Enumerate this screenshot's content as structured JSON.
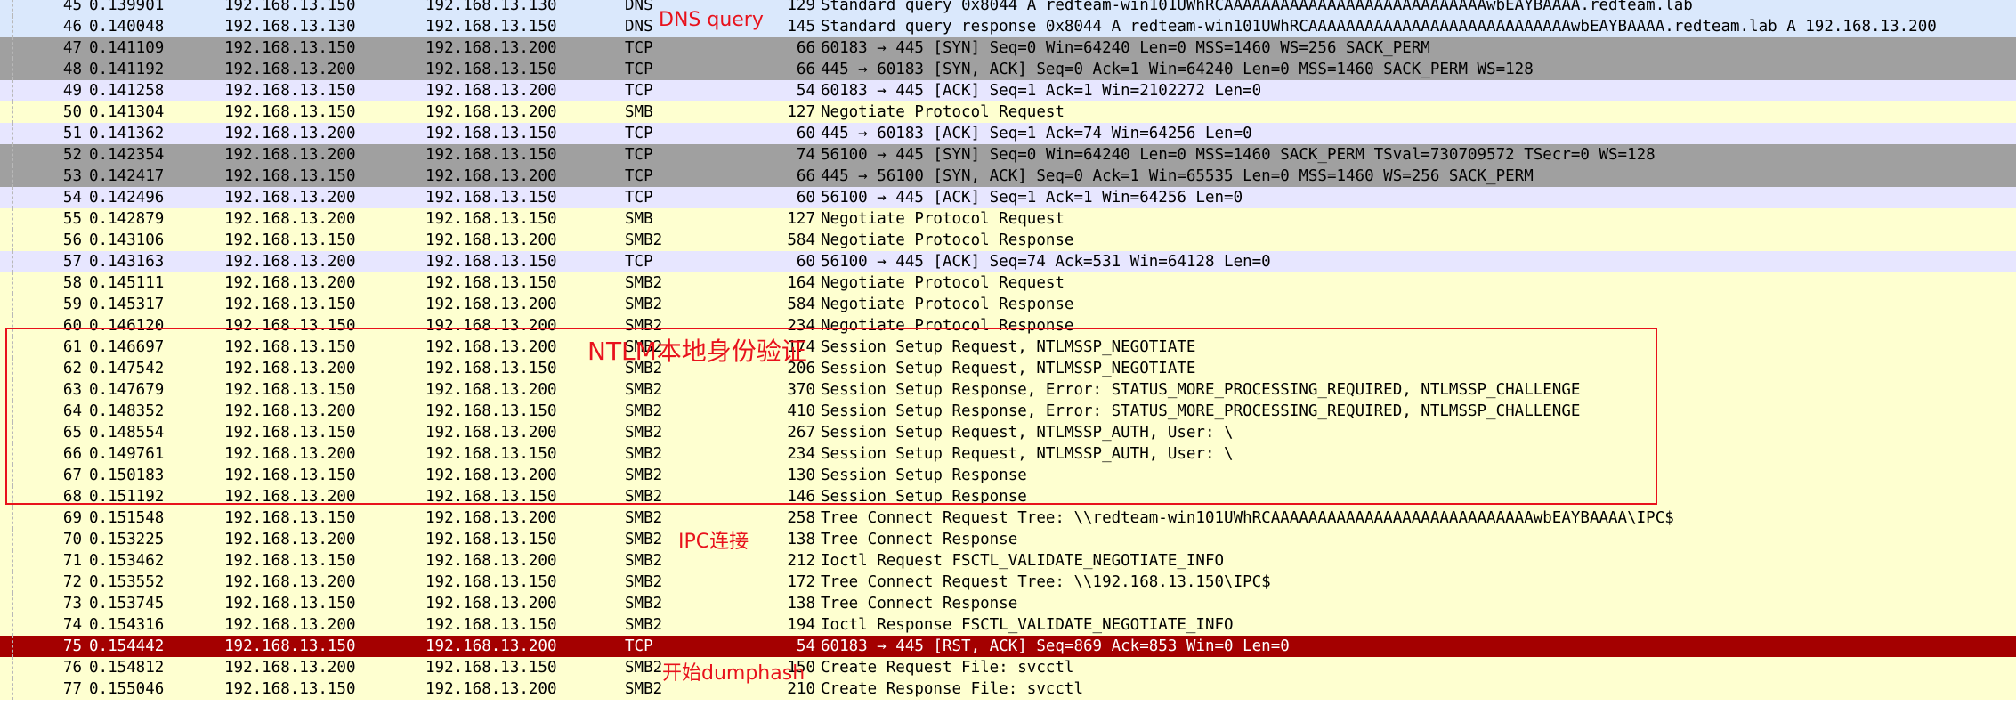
{
  "colors": {
    "dns": "#dae8fc",
    "tcp_handshake": "#a0a0a0",
    "tcp": "#e7e6ff",
    "smb": "#feffd0",
    "rst": "#a40000",
    "annotation": "#e8121c"
  },
  "packets": [
    {
      "no": "45",
      "time": "0.139901",
      "src": "192.168.13.150",
      "dst": "192.168.13.130",
      "proto": "DNS",
      "len": "129",
      "info": "Standard query 0x8044 A redteam-win101UWhRCAAAAAAAAAAAAAAAAAAAAAAAAAAAAwbEAYBAAAA.redteam.lab",
      "style": "dns"
    },
    {
      "no": "46",
      "time": "0.140048",
      "src": "192.168.13.130",
      "dst": "192.168.13.150",
      "proto": "DNS",
      "len": "145",
      "info": "Standard query response 0x8044 A redteam-win101UWhRCAAAAAAAAAAAAAAAAAAAAAAAAAAAAwbEAYBAAAA.redteam.lab A 192.168.13.200",
      "style": "dns"
    },
    {
      "no": "47",
      "time": "0.141109",
      "src": "192.168.13.150",
      "dst": "192.168.13.200",
      "proto": "TCP",
      "len": "66",
      "info": "60183 → 445 [SYN] Seq=0 Win=64240 Len=0 MSS=1460 WS=256 SACK_PERM",
      "style": "tcp_handshake"
    },
    {
      "no": "48",
      "time": "0.141192",
      "src": "192.168.13.200",
      "dst": "192.168.13.150",
      "proto": "TCP",
      "len": "66",
      "info": "445 → 60183 [SYN, ACK] Seq=0 Ack=1 Win=64240 Len=0 MSS=1460 SACK_PERM WS=128",
      "style": "tcp_handshake"
    },
    {
      "no": "49",
      "time": "0.141258",
      "src": "192.168.13.150",
      "dst": "192.168.13.200",
      "proto": "TCP",
      "len": "54",
      "info": "60183 → 445 [ACK] Seq=1 Ack=1 Win=2102272 Len=0",
      "style": "tcp"
    },
    {
      "no": "50",
      "time": "0.141304",
      "src": "192.168.13.150",
      "dst": "192.168.13.200",
      "proto": "SMB",
      "len": "127",
      "info": "Negotiate Protocol Request",
      "style": "smb"
    },
    {
      "no": "51",
      "time": "0.141362",
      "src": "192.168.13.200",
      "dst": "192.168.13.150",
      "proto": "TCP",
      "len": "60",
      "info": "445 → 60183 [ACK] Seq=1 Ack=74 Win=64256 Len=0",
      "style": "tcp"
    },
    {
      "no": "52",
      "time": "0.142354",
      "src": "192.168.13.200",
      "dst": "192.168.13.150",
      "proto": "TCP",
      "len": "74",
      "info": "56100 → 445 [SYN] Seq=0 Win=64240 Len=0 MSS=1460 SACK_PERM TSval=730709572 TSecr=0 WS=128",
      "style": "tcp_handshake"
    },
    {
      "no": "53",
      "time": "0.142417",
      "src": "192.168.13.150",
      "dst": "192.168.13.200",
      "proto": "TCP",
      "len": "66",
      "info": "445 → 56100 [SYN, ACK] Seq=0 Ack=1 Win=65535 Len=0 MSS=1460 WS=256 SACK_PERM",
      "style": "tcp_handshake"
    },
    {
      "no": "54",
      "time": "0.142496",
      "src": "192.168.13.200",
      "dst": "192.168.13.150",
      "proto": "TCP",
      "len": "60",
      "info": "56100 → 445 [ACK] Seq=1 Ack=1 Win=64256 Len=0",
      "style": "tcp"
    },
    {
      "no": "55",
      "time": "0.142879",
      "src": "192.168.13.200",
      "dst": "192.168.13.150",
      "proto": "SMB",
      "len": "127",
      "info": "Negotiate Protocol Request",
      "style": "smb"
    },
    {
      "no": "56",
      "time": "0.143106",
      "src": "192.168.13.150",
      "dst": "192.168.13.200",
      "proto": "SMB2",
      "len": "584",
      "info": "Negotiate Protocol Response",
      "style": "smb"
    },
    {
      "no": "57",
      "time": "0.143163",
      "src": "192.168.13.200",
      "dst": "192.168.13.150",
      "proto": "TCP",
      "len": "60",
      "info": "56100 → 445 [ACK] Seq=74 Ack=531 Win=64128 Len=0",
      "style": "tcp"
    },
    {
      "no": "58",
      "time": "0.145111",
      "src": "192.168.13.200",
      "dst": "192.168.13.150",
      "proto": "SMB2",
      "len": "164",
      "info": "Negotiate Protocol Request",
      "style": "smb"
    },
    {
      "no": "59",
      "time": "0.145317",
      "src": "192.168.13.150",
      "dst": "192.168.13.200",
      "proto": "SMB2",
      "len": "584",
      "info": "Negotiate Protocol Response",
      "style": "smb"
    },
    {
      "no": "60",
      "time": "0.146120",
      "src": "192.168.13.150",
      "dst": "192.168.13.200",
      "proto": "SMB2",
      "len": "234",
      "info": "Negotiate Protocol Response",
      "style": "smb"
    },
    {
      "no": "61",
      "time": "0.146697",
      "src": "192.168.13.150",
      "dst": "192.168.13.200",
      "proto": "SMB2",
      "len": "174",
      "info": "Session Setup Request, NTLMSSP_NEGOTIATE",
      "style": "smb"
    },
    {
      "no": "62",
      "time": "0.147542",
      "src": "192.168.13.200",
      "dst": "192.168.13.150",
      "proto": "SMB2",
      "len": "206",
      "info": "Session Setup Request, NTLMSSP_NEGOTIATE",
      "style": "smb"
    },
    {
      "no": "63",
      "time": "0.147679",
      "src": "192.168.13.150",
      "dst": "192.168.13.200",
      "proto": "SMB2",
      "len": "370",
      "info": "Session Setup Response, Error: STATUS_MORE_PROCESSING_REQUIRED, NTLMSSP_CHALLENGE",
      "style": "smb"
    },
    {
      "no": "64",
      "time": "0.148352",
      "src": "192.168.13.200",
      "dst": "192.168.13.150",
      "proto": "SMB2",
      "len": "410",
      "info": "Session Setup Response, Error: STATUS_MORE_PROCESSING_REQUIRED, NTLMSSP_CHALLENGE",
      "style": "smb"
    },
    {
      "no": "65",
      "time": "0.148554",
      "src": "192.168.13.150",
      "dst": "192.168.13.200",
      "proto": "SMB2",
      "len": "267",
      "info": "Session Setup Request, NTLMSSP_AUTH, User: \\",
      "style": "smb"
    },
    {
      "no": "66",
      "time": "0.149761",
      "src": "192.168.13.200",
      "dst": "192.168.13.150",
      "proto": "SMB2",
      "len": "234",
      "info": "Session Setup Request, NTLMSSP_AUTH, User: \\",
      "style": "smb"
    },
    {
      "no": "67",
      "time": "0.150183",
      "src": "192.168.13.150",
      "dst": "192.168.13.200",
      "proto": "SMB2",
      "len": "130",
      "info": "Session Setup Response",
      "style": "smb"
    },
    {
      "no": "68",
      "time": "0.151192",
      "src": "192.168.13.200",
      "dst": "192.168.13.150",
      "proto": "SMB2",
      "len": "146",
      "info": "Session Setup Response",
      "style": "smb"
    },
    {
      "no": "69",
      "time": "0.151548",
      "src": "192.168.13.150",
      "dst": "192.168.13.200",
      "proto": "SMB2",
      "len": "258",
      "info": "Tree Connect Request Tree: \\\\redteam-win101UWhRCAAAAAAAAAAAAAAAAAAAAAAAAAAAAwbEAYBAAAA\\IPC$",
      "style": "smb"
    },
    {
      "no": "70",
      "time": "0.153225",
      "src": "192.168.13.200",
      "dst": "192.168.13.150",
      "proto": "SMB2",
      "len": "138",
      "info": "Tree Connect Response",
      "style": "smb"
    },
    {
      "no": "71",
      "time": "0.153462",
      "src": "192.168.13.150",
      "dst": "192.168.13.200",
      "proto": "SMB2",
      "len": "212",
      "info": "Ioctl Request FSCTL_VALIDATE_NEGOTIATE_INFO",
      "style": "smb"
    },
    {
      "no": "72",
      "time": "0.153552",
      "src": "192.168.13.200",
      "dst": "192.168.13.150",
      "proto": "SMB2",
      "len": "172",
      "info": "Tree Connect Request Tree: \\\\192.168.13.150\\IPC$",
      "style": "smb"
    },
    {
      "no": "73",
      "time": "0.153745",
      "src": "192.168.13.150",
      "dst": "192.168.13.200",
      "proto": "SMB2",
      "len": "138",
      "info": "Tree Connect Response",
      "style": "smb"
    },
    {
      "no": "74",
      "time": "0.154316",
      "src": "192.168.13.200",
      "dst": "192.168.13.150",
      "proto": "SMB2",
      "len": "194",
      "info": "Ioctl Response FSCTL_VALIDATE_NEGOTIATE_INFO",
      "style": "smb"
    },
    {
      "no": "75",
      "time": "0.154442",
      "src": "192.168.13.150",
      "dst": "192.168.13.200",
      "proto": "TCP",
      "len": "54",
      "info": "60183 → 445 [RST, ACK] Seq=869 Ack=853 Win=0 Len=0",
      "style": "rst"
    },
    {
      "no": "76",
      "time": "0.154812",
      "src": "192.168.13.200",
      "dst": "192.168.13.150",
      "proto": "SMB2",
      "len": "150",
      "info": "Create Request File: svcctl",
      "style": "smb"
    },
    {
      "no": "77",
      "time": "0.155046",
      "src": "192.168.13.150",
      "dst": "192.168.13.200",
      "proto": "SMB2",
      "len": "210",
      "info": "Create Response File: svcctl",
      "style": "smb"
    }
  ],
  "annotations": {
    "dns_query": "DNS query",
    "ntlm_local_auth": "NTLM本地身份验证",
    "ipc_connect": "IPC连接",
    "start_dumphash": "开始dumphash"
  }
}
